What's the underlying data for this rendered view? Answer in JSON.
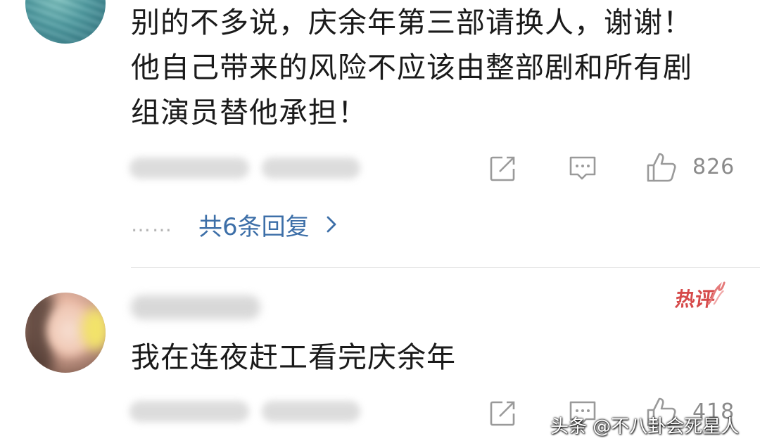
{
  "comments": [
    {
      "text": "别的不多说，庆余年第三部请换人，谢谢！\n他自己带来的风险不应该由整部剧和所有剧\n组演员替他承担！",
      "likes": "826",
      "replies_label": "共6条回复",
      "replies_dots": "……"
    },
    {
      "badge": "热评",
      "text": "我在连夜赶工看完庆余年",
      "likes": "418"
    }
  ],
  "watermark": "头条 @不八卦会死星人",
  "icons": {
    "share": "share-icon",
    "reply": "reply-icon",
    "like": "thumbs-up-icon",
    "chevron": "chevron-right-icon"
  },
  "colors": {
    "text": "#1a1a1a",
    "link": "#3d6fa8",
    "icon": "#9a9a9a",
    "badge": "#d64a4a"
  }
}
